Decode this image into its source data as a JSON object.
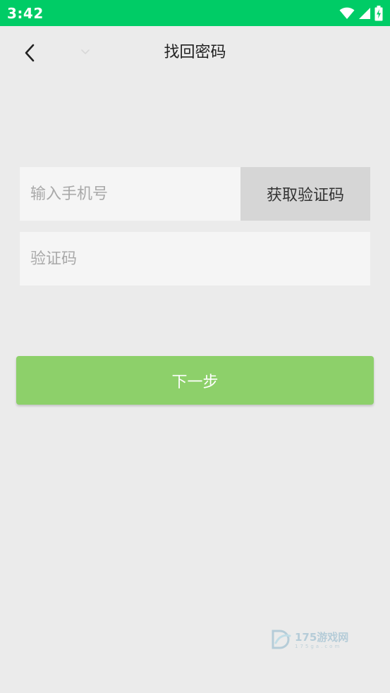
{
  "status_bar": {
    "time": "3:42",
    "background_color": "#00cc66",
    "icons": [
      "wifi-icon",
      "cellular-signal-icon",
      "battery-charging-icon"
    ]
  },
  "header": {
    "title": "找回密码",
    "back_icon": "chevron-left-icon",
    "dropdown_icon": "chevron-down-icon"
  },
  "form": {
    "phone": {
      "placeholder": "输入手机号",
      "value": ""
    },
    "get_code_button": "获取验证码",
    "code": {
      "placeholder": "验证码",
      "value": ""
    },
    "next_button": "下一步"
  },
  "colors": {
    "accent_green": "#8dd06a",
    "background": "#ebebeb",
    "input_background": "#f5f5f5",
    "code_button_background": "#d6d6d6"
  },
  "watermark": {
    "text": "175游戏网",
    "sub": "175ga.com"
  }
}
